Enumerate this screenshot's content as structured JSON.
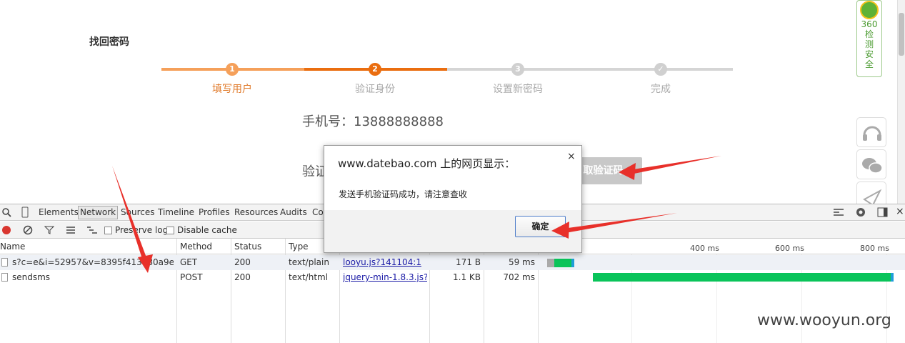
{
  "page": {
    "title": "找回密码",
    "steps": [
      {
        "num": "1",
        "label": "填写用户"
      },
      {
        "num": "2",
        "label": "验证身份"
      },
      {
        "num": "3",
        "label": "设置新密码"
      },
      {
        "num": "✓",
        "label": "完成"
      }
    ],
    "phone_line": "手机号：13888888888",
    "code_label": "验证",
    "get_code_button": "取验证码"
  },
  "side": {
    "badge_lines": [
      "360",
      "检",
      "测",
      "安",
      "全"
    ]
  },
  "devtools": {
    "tabs": [
      "Elements",
      "Network",
      "Sources",
      "Timeline",
      "Profiles",
      "Resources",
      "Audits",
      "Co"
    ],
    "active_tab": "Network",
    "toolbar": {
      "preserve_log": "Preserve log",
      "disable_cache": "Disable cache"
    },
    "columns": [
      "Name",
      "Method",
      "Status",
      "Type"
    ],
    "timeline_ticks": [
      "400 ms",
      "600 ms",
      "800 ms"
    ],
    "rows": [
      {
        "name": "s?c=e&i=52957&v=8395f413080a9e8b5e...",
        "method": "GET",
        "status": "200",
        "type": "text/plain",
        "initiator": "looyu.js?141104:1",
        "size": "171 B",
        "time": "59 ms"
      },
      {
        "name": "sendsms",
        "method": "POST",
        "status": "200",
        "type": "text/html",
        "initiator": "jquery-min-1.8.3.js?...",
        "size": "1.1 KB",
        "time": "702 ms"
      }
    ]
  },
  "dialog": {
    "title": "www.datebao.com 上的网页显示：",
    "close": "×",
    "message": "发送手机验证码成功，请注意查收",
    "ok_button": "确定"
  },
  "watermark": "www.wooyun.org",
  "colors": {
    "step_done": "#f5a05a",
    "step_active": "#ea6d0f",
    "step_todo": "#d5d5d5",
    "bar_green": "#0ac45a",
    "bar_blue": "#1f9ed8"
  }
}
